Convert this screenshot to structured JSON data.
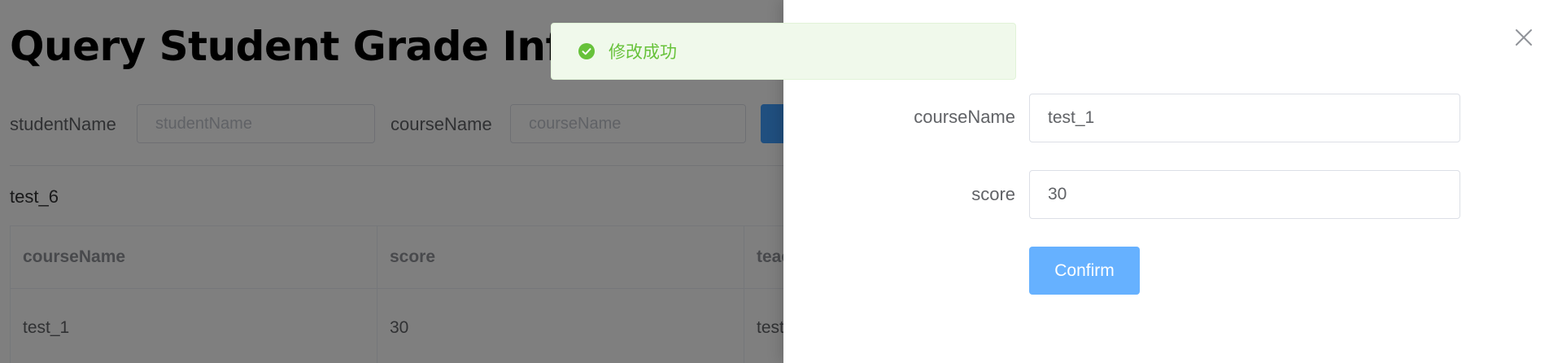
{
  "page": {
    "title": "Query Student Grade Info"
  },
  "search": {
    "student_label": "studentName",
    "student_placeholder": "studentName",
    "course_label": "courseName",
    "course_placeholder": "courseName"
  },
  "student": {
    "name": "test_6"
  },
  "table": {
    "headers": [
      "courseName",
      "score",
      "teacherName"
    ],
    "rows": [
      [
        "test_1",
        "30",
        "test"
      ]
    ]
  },
  "toast": {
    "message": "修改成功",
    "type": "success",
    "color": "#67c23a"
  },
  "drawer": {
    "course_label": "courseName",
    "course_value": "test_1",
    "score_label": "score",
    "score_value": "30",
    "confirm_label": "Confirm",
    "close_icon": "close-icon"
  },
  "colors": {
    "primary": "#409eff",
    "primary_light": "#66b1ff",
    "success": "#67c23a",
    "overlay": "rgba(0,0,0,0.5)"
  }
}
